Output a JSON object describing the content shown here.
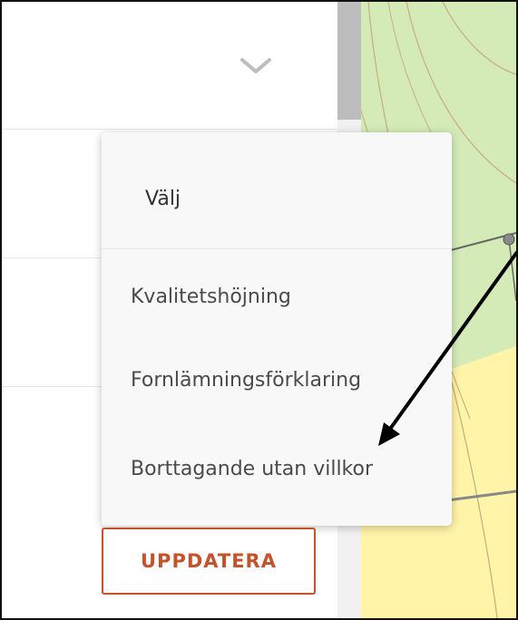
{
  "dropdown": {
    "selected_label": "Välj",
    "options": [
      {
        "label": "Kvalitetshöjning"
      },
      {
        "label": "Fornlämningsförklaring"
      },
      {
        "label": "Borttagande utan villkor"
      }
    ]
  },
  "button": {
    "label": "UPPDATERA"
  },
  "colors": {
    "accent": "#c5522a",
    "map_green": "#d4ebb8",
    "map_yellow": "#fff4a8"
  },
  "icons": {
    "collapse": "chevron-down-icon",
    "annotation": "arrow-annotation"
  }
}
